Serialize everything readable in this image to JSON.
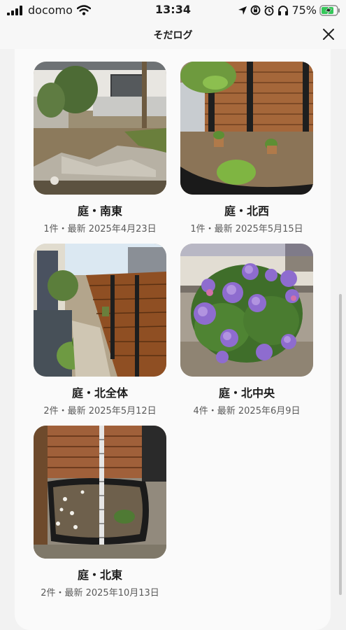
{
  "status_bar": {
    "carrier": "docomo",
    "time": "13:34",
    "battery": "75%"
  },
  "header": {
    "title": "そだログ"
  },
  "cards": [
    {
      "title": "庭・南東",
      "meta": "1件・最新 2025年4月23日"
    },
    {
      "title": "庭・北西",
      "meta": "1件・最新 2025年5月15日"
    },
    {
      "title": "庭・北全体",
      "meta": "2件・最新 2025年5月12日"
    },
    {
      "title": "庭・北中央",
      "meta": "4件・最新 2025年6月9日"
    },
    {
      "title": "庭・北東",
      "meta": "2件・最新 2025年10月13日"
    }
  ]
}
